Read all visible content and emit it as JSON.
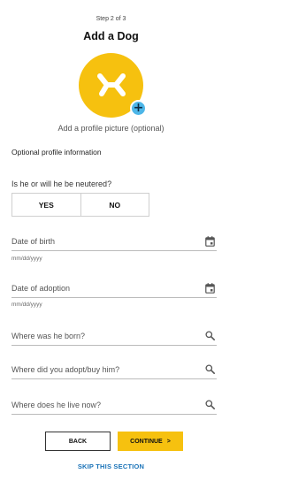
{
  "header": {
    "step": "Step 2 of 3",
    "title": "Add a Dog"
  },
  "profile_picture": {
    "add_icon": "plus-icon",
    "label": "Add a profile picture (optional)"
  },
  "section": {
    "label": "Optional profile information"
  },
  "neutered": {
    "question": "Is he or will he be neutered?",
    "yes_label": "YES",
    "no_label": "NO"
  },
  "fields": {
    "date_of_birth": {
      "label": "Date of birth",
      "hint": "mm/dd/yyyy",
      "icon": "calendar-icon"
    },
    "date_of_adoption": {
      "label": "Date of adoption",
      "hint": "mm/dd/yyyy",
      "icon": "calendar-icon"
    },
    "born_location": {
      "label": "Where was he born?",
      "icon": "search-icon"
    },
    "adopt_location": {
      "label": "Where did you adopt/buy him?",
      "icon": "search-icon"
    },
    "live_location": {
      "label": "Where does he live now?",
      "icon": "search-icon"
    }
  },
  "actions": {
    "back_label": "BACK",
    "continue_label": "CONTINUE",
    "continue_chevron": ">",
    "skip_label": "SKIP THIS SECTION"
  },
  "colors": {
    "accent": "#f6c10f",
    "add_button": "#4db6e8",
    "link": "#1a73b8"
  }
}
